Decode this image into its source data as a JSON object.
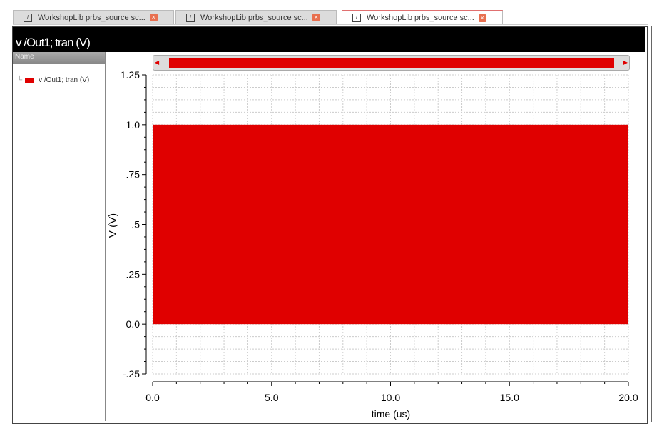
{
  "tabs": [
    {
      "label": "WorkshopLib prbs_source sc...",
      "active": false
    },
    {
      "label": "WorkshopLib prbs_source sc...",
      "active": false
    },
    {
      "label": "WorkshopLib prbs_source sc...",
      "active": true
    }
  ],
  "header": {
    "title": "v /Out1; tran (V)"
  },
  "legend_panel": {
    "column_header": "Name",
    "items": [
      {
        "label": "v /Out1; tran (V)",
        "color": "#e00000"
      }
    ]
  },
  "chart_data": {
    "type": "area",
    "title": "v /Out1; tran (V)",
    "xlabel": "time (us)",
    "ylabel": "V (V)",
    "xlim": [
      0,
      20
    ],
    "ylim": [
      -0.25,
      1.25
    ],
    "xticks": [
      "0.0",
      "5.0",
      "10.0",
      "15.0",
      "20.0"
    ],
    "xtick_values": [
      0,
      5,
      10,
      15,
      20
    ],
    "yticks": [
      "-.25",
      "0.0",
      ".25",
      ".5",
      ".75",
      "1.0",
      "1.25"
    ],
    "ytick_values": [
      -0.25,
      0,
      0.25,
      0.5,
      0.75,
      1.0,
      1.25
    ],
    "grid": true,
    "series": [
      {
        "name": "v /Out1; tran (V)",
        "color": "#e00000",
        "description_values": {
          "low": 0.0,
          "high": 1.0,
          "x_start": 0,
          "x_end": 20
        }
      }
    ]
  }
}
